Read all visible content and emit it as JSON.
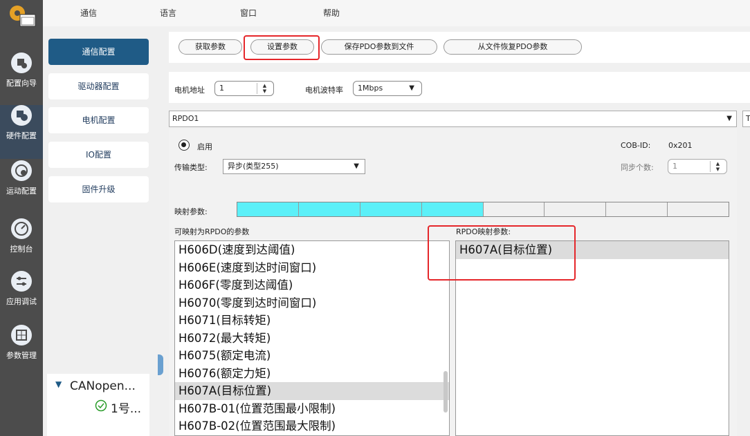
{
  "rail": {
    "items": [
      {
        "label": "配置向导",
        "icon": "wizard-icon"
      },
      {
        "label": "硬件配置",
        "icon": "hardware-icon"
      },
      {
        "label": "运动配置",
        "icon": "motion-icon"
      },
      {
        "label": "控制台",
        "icon": "gauge-icon"
      },
      {
        "label": "应用调试",
        "icon": "sliders-icon"
      },
      {
        "label": "参数管理",
        "icon": "grid-icon"
      }
    ]
  },
  "menu": {
    "comm": "通信",
    "lang": "语言",
    "window": "窗口",
    "help": "帮助"
  },
  "subnav": {
    "items": [
      "通信配置",
      "驱动器配置",
      "电机配置",
      "IO配置",
      "固件升级"
    ],
    "tree_root": "CANopen...",
    "tree_child": "1号..."
  },
  "toolbar": {
    "get_params": "获取参数",
    "set_params": "设置参数",
    "save_pdo": "保存PDO参数到文件",
    "restore_pdo": "从文件恢复PDO参数"
  },
  "motor": {
    "address_label": "电机地址",
    "address_value": "1",
    "baud_label": "电机波特率",
    "baud_value": "1Mbps"
  },
  "rpdo": {
    "selected": "RPDO1",
    "tpdo_edge": "T",
    "enable_label": "启用",
    "cob_id_label": "COB-ID:",
    "cob_id_value": "0x201",
    "transfer_type_label": "传输类型:",
    "transfer_type_value": "异步(类型255)",
    "sync_count_label": "同步个数:",
    "sync_count_value": "1",
    "mapping_label": "映射参数:",
    "mapping_filled_cells": 4,
    "mapping_total_cells": 8,
    "available_title": "可映射为RPDO的参数",
    "mapped_title": "RPDO映射参数:",
    "available_params": [
      "H606D(速度到达阈值)",
      "H606E(速度到达时间窗口)",
      "H606F(零度到达阈值)",
      "H6070(零度到达时间窗口)",
      "H6071(目标转矩)",
      "H6072(最大转矩)",
      "H6075(额定电流)",
      "H6076(额定力矩)",
      "H607A(目标位置)",
      "H607B-01(位置范围最小限制)",
      "H607B-02(位置范围最大限制)"
    ],
    "available_selected_index": 8,
    "mapped_params": [
      "H607A(目标位置)"
    ]
  },
  "colors": {
    "highlight": "#e5262a",
    "mapping_fill": "#5cf0f8",
    "nav_active": "#1f5b86"
  }
}
